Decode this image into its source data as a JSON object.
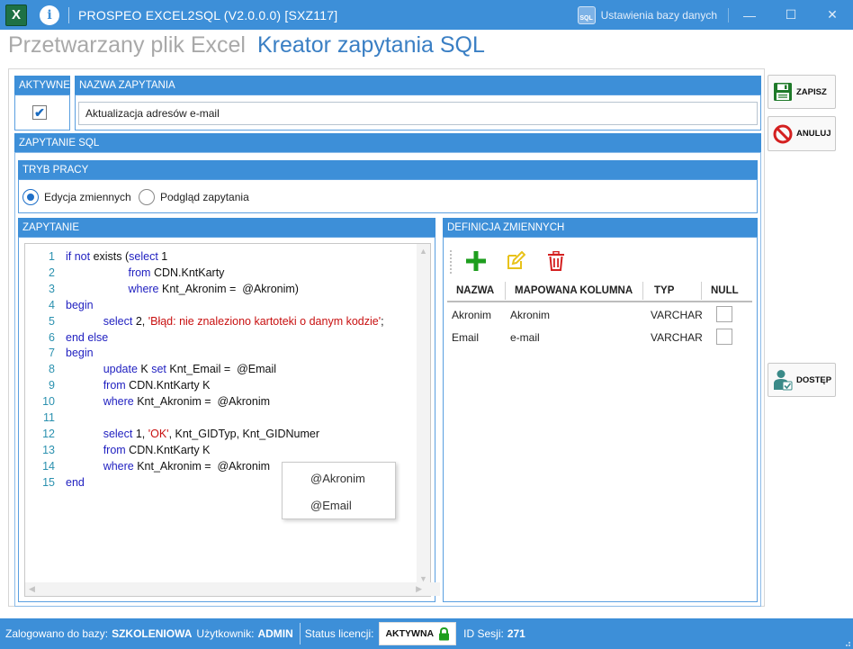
{
  "window": {
    "title": "PROSPEO EXCEL2SQL (V2.0.0.0) [SXZ117]",
    "db_settings_label": "Ustawienia bazy danych",
    "excel_icon_letter": "X",
    "info_icon_letter": "i",
    "sql_icon_text": "SQL",
    "minimize_glyph": "—",
    "maximize_glyph": "☐",
    "close_glyph": "✕"
  },
  "headings": {
    "inactive": "Przetwarzany plik Excel",
    "active": "Kreator zapytania SQL"
  },
  "query": {
    "active_header": "AKTYWNE",
    "name_header": "NAZWA ZAPYTANIA",
    "active_checked": true,
    "check_glyph": "✔",
    "name_value": "Aktualizacja adresów e-mail"
  },
  "sql_section": {
    "header": "ZAPYTANIE SQL",
    "mode_header": "TRYB PRACY",
    "modes": [
      {
        "label": "Edycja zmiennych",
        "selected": true
      },
      {
        "label": "Podgląd zapytania",
        "selected": false
      }
    ],
    "editor_header": "ZAPYTANIE",
    "code_lines": [
      [
        {
          "t": "if not",
          "c": "kw"
        },
        {
          "t": " exists (",
          "c": ""
        },
        {
          "t": "select",
          "c": "kw"
        },
        {
          "t": " 1",
          "c": ""
        }
      ],
      [
        {
          "t": "                    ",
          "c": ""
        },
        {
          "t": "from",
          "c": "kw"
        },
        {
          "t": " CDN.KntKarty",
          "c": ""
        }
      ],
      [
        {
          "t": "                    ",
          "c": ""
        },
        {
          "t": "where",
          "c": "kw"
        },
        {
          "t": " Knt_Akronim =  @Akronim)",
          "c": ""
        }
      ],
      [
        {
          "t": "begin",
          "c": "kw"
        }
      ],
      [
        {
          "t": "            ",
          "c": ""
        },
        {
          "t": "select",
          "c": "kw"
        },
        {
          "t": " 2, ",
          "c": ""
        },
        {
          "t": "'Błąd: nie znaleziono kartoteki o danym kodzie'",
          "c": "str"
        },
        {
          "t": ";",
          "c": ""
        }
      ],
      [
        {
          "t": "end else",
          "c": "kw"
        }
      ],
      [
        {
          "t": "begin",
          "c": "kw"
        }
      ],
      [
        {
          "t": "            ",
          "c": ""
        },
        {
          "t": "update",
          "c": "kw"
        },
        {
          "t": " K ",
          "c": ""
        },
        {
          "t": "set",
          "c": "kw"
        },
        {
          "t": " Knt_Email =  @Email",
          "c": ""
        }
      ],
      [
        {
          "t": "            ",
          "c": ""
        },
        {
          "t": "from",
          "c": "kw"
        },
        {
          "t": " CDN.KntKarty K",
          "c": ""
        }
      ],
      [
        {
          "t": "            ",
          "c": ""
        },
        {
          "t": "where",
          "c": "kw"
        },
        {
          "t": " Knt_Akronim =  @Akronim",
          "c": ""
        }
      ],
      [],
      [
        {
          "t": "            ",
          "c": ""
        },
        {
          "t": "select",
          "c": "kw"
        },
        {
          "t": " 1, ",
          "c": ""
        },
        {
          "t": "'OK'",
          "c": "str"
        },
        {
          "t": ", Knt_GIDTyp, Knt_GIDNumer",
          "c": ""
        }
      ],
      [
        {
          "t": "            ",
          "c": ""
        },
        {
          "t": "from",
          "c": "kw"
        },
        {
          "t": " CDN.KntKarty K",
          "c": ""
        }
      ],
      [
        {
          "t": "            ",
          "c": ""
        },
        {
          "t": "where",
          "c": "kw"
        },
        {
          "t": " Knt_Akronim =  @Akronim",
          "c": ""
        }
      ],
      [
        {
          "t": "end",
          "c": "kw"
        }
      ]
    ],
    "line_numbers": [
      "1",
      "2",
      "3",
      "4",
      "5",
      "6",
      "7",
      "8",
      "9",
      "10",
      "11",
      "12",
      "13",
      "14",
      "15"
    ],
    "autocomplete": [
      "@Akronim",
      "@Email"
    ]
  },
  "variables": {
    "header": "DEFINICJA ZMIENNYCH",
    "columns": [
      "NAZWA",
      "MAPOWANA KOLUMNA",
      "TYP",
      "NULL"
    ],
    "rows": [
      {
        "name": "Akronim",
        "column": "Akronim",
        "type": "VARCHAR",
        "null": false
      },
      {
        "name": "Email",
        "column": "e-mail",
        "type": "VARCHAR",
        "null": false
      }
    ]
  },
  "buttons": {
    "save": "ZAPISZ",
    "cancel": "ANULUJ",
    "access": "DOSTĘP"
  },
  "status": {
    "logged_label": "Zalogowano do bazy:",
    "db_name": "SZKOLENIOWA",
    "user_label": "Użytkownik:",
    "user_name": "ADMIN",
    "license_label": "Status licencji:",
    "license_value": "AKTYWNA",
    "session_label": "ID Sesji:",
    "session_id": "271"
  },
  "colors": {
    "accent": "#3d8fd8",
    "keyword": "#1f1fc0",
    "string": "#c81010",
    "line_number": "#2b91af",
    "add_icon": "#1e9e1e",
    "edit_icon": "#e8c21a",
    "delete_icon": "#d42020"
  }
}
